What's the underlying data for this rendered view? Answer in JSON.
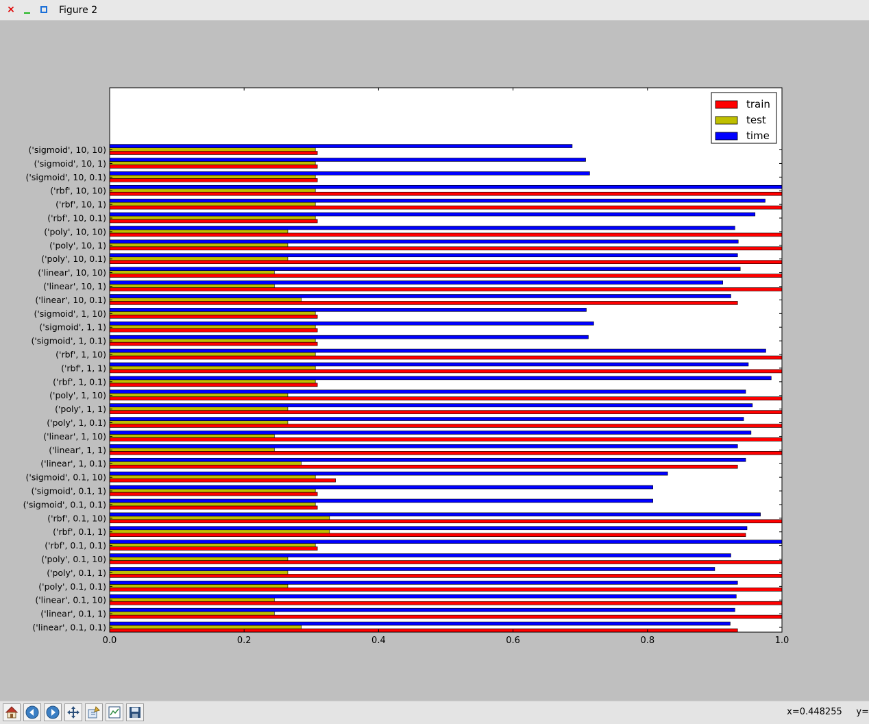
{
  "window": {
    "title": "Figure 2",
    "close_glyph": "×"
  },
  "toolbar": {
    "buttons": [
      {
        "name": "home-button",
        "icon": "home-icon"
      },
      {
        "name": "back-button",
        "icon": "arrow-left-icon"
      },
      {
        "name": "forward-button",
        "icon": "arrow-right-icon"
      },
      {
        "name": "pan-button",
        "icon": "move-icon"
      },
      {
        "name": "zoom-button",
        "icon": "zoom-rect-icon"
      },
      {
        "name": "subplots-button",
        "icon": "subplots-icon"
      },
      {
        "name": "save-button",
        "icon": "save-icon"
      }
    ],
    "coords": "x=0.448255     y="
  },
  "chart_data": {
    "type": "bar",
    "orientation": "horizontal",
    "xlim": [
      0.0,
      1.0
    ],
    "xticks": [
      "0.0",
      "0.2",
      "0.4",
      "0.6",
      "0.8",
      "1.0"
    ],
    "grid": false,
    "legend_position": "top-right",
    "categories": [
      "('linear', 0.1, 0.1)",
      "('linear', 0.1, 1)",
      "('linear', 0.1, 10)",
      "('poly', 0.1, 0.1)",
      "('poly', 0.1, 1)",
      "('poly', 0.1, 10)",
      "('rbf', 0.1, 0.1)",
      "('rbf', 0.1, 1)",
      "('rbf', 0.1, 10)",
      "('sigmoid', 0.1, 0.1)",
      "('sigmoid', 0.1, 1)",
      "('sigmoid', 0.1, 10)",
      "('linear', 1, 0.1)",
      "('linear', 1, 1)",
      "('linear', 1, 10)",
      "('poly', 1, 0.1)",
      "('poly', 1, 1)",
      "('poly', 1, 10)",
      "('rbf', 1, 0.1)",
      "('rbf', 1, 1)",
      "('rbf', 1, 10)",
      "('sigmoid', 1, 0.1)",
      "('sigmoid', 1, 1)",
      "('sigmoid', 1, 10)",
      "('linear', 10, 0.1)",
      "('linear', 10, 1)",
      "('linear', 10, 10)",
      "('poly', 10, 0.1)",
      "('poly', 10, 1)",
      "('poly', 10, 10)",
      "('rbf', 10, 0.1)",
      "('rbf', 10, 1)",
      "('rbf', 10, 10)",
      "('sigmoid', 10, 0.1)",
      "('sigmoid', 10, 1)",
      "('sigmoid', 10, 10)"
    ],
    "series": [
      {
        "name": "train",
        "color": "#ff0000",
        "values": [
          0.934,
          1.0,
          1.0,
          1.0,
          1.0,
          1.0,
          0.309,
          0.946,
          1.0,
          0.309,
          0.309,
          0.336,
          0.934,
          1.0,
          1.0,
          1.0,
          1.0,
          1.0,
          0.309,
          1.0,
          1.0,
          0.309,
          0.309,
          0.309,
          0.934,
          1.0,
          1.0,
          1.0,
          1.0,
          1.0,
          0.309,
          1.0,
          1.0,
          0.309,
          0.309,
          0.309
        ]
      },
      {
        "name": "test",
        "color": "#bfbf00",
        "values": [
          0.285,
          0.245,
          0.245,
          0.265,
          0.265,
          0.265,
          0.306,
          0.327,
          0.327,
          0.306,
          0.306,
          0.306,
          0.285,
          0.245,
          0.245,
          0.265,
          0.265,
          0.265,
          0.306,
          0.306,
          0.306,
          0.306,
          0.306,
          0.306,
          0.285,
          0.245,
          0.245,
          0.265,
          0.265,
          0.265,
          0.306,
          0.306,
          0.306,
          0.306,
          0.306,
          0.306
        ]
      },
      {
        "name": "time",
        "color": "#0000ff",
        "values": [
          0.923,
          0.93,
          0.932,
          0.934,
          0.9,
          0.924,
          1.0,
          0.948,
          0.968,
          0.808,
          0.808,
          0.83,
          0.946,
          0.934,
          0.954,
          0.943,
          0.956,
          0.946,
          0.984,
          0.95,
          0.976,
          0.712,
          0.72,
          0.709,
          0.924,
          0.912,
          0.938,
          0.934,
          0.935,
          0.93,
          0.96,
          0.975,
          1.0,
          0.714,
          0.708,
          0.688
        ]
      }
    ]
  }
}
